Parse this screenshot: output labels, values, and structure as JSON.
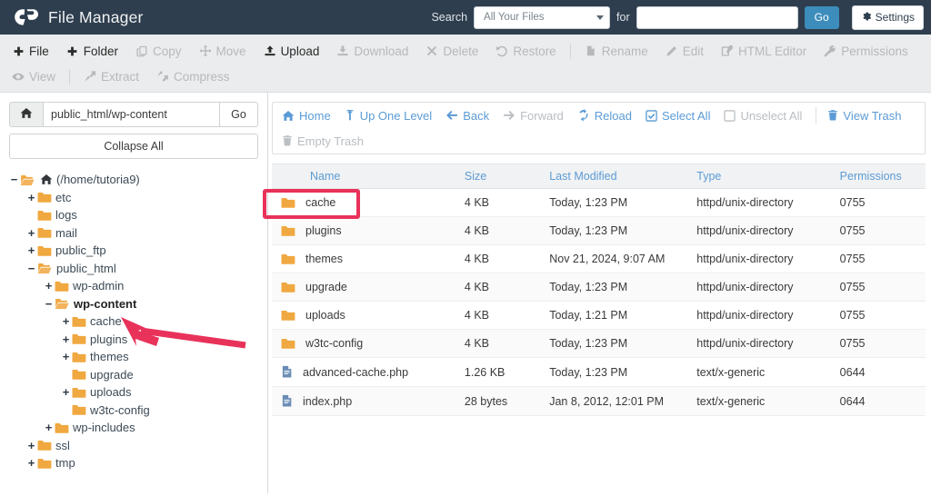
{
  "header": {
    "brand_title": "File Manager",
    "logo_icon": "cpanel-logo-icon",
    "search_label": "Search",
    "search_scope_value": "All Your Files",
    "for_label": "for",
    "search_value": "",
    "search_placeholder": "",
    "go_label": "Go",
    "settings_label": "Settings",
    "settings_icon": "gear-icon",
    "bg_color": "#2e3e4e",
    "accent_color": "#3c8dbc"
  },
  "toolbar": {
    "row1": [
      {
        "label": "File",
        "icon": "plus-icon",
        "enabled": true,
        "sep_after": false
      },
      {
        "label": "Folder",
        "icon": "plus-icon",
        "enabled": true,
        "sep_after": false
      },
      {
        "label": "Copy",
        "icon": "copy-icon",
        "enabled": false,
        "sep_after": false
      },
      {
        "label": "Move",
        "icon": "move-icon",
        "enabled": false,
        "sep_after": false
      },
      {
        "label": "Upload",
        "icon": "upload-icon",
        "enabled": true,
        "sep_after": false
      },
      {
        "label": "Download",
        "icon": "download-icon",
        "enabled": false,
        "sep_after": false
      },
      {
        "label": "Delete",
        "icon": "x-icon",
        "enabled": false,
        "sep_after": false
      },
      {
        "label": "Restore",
        "icon": "restore-icon",
        "enabled": false,
        "sep_after": true
      },
      {
        "label": "Rename",
        "icon": "file-icon",
        "enabled": false,
        "sep_after": false
      },
      {
        "label": "Edit",
        "icon": "pencil-icon",
        "enabled": false,
        "sep_after": false
      },
      {
        "label": "HTML Editor",
        "icon": "html-editor-icon",
        "enabled": false,
        "sep_after": false
      },
      {
        "label": "Permissions",
        "icon": "key-icon",
        "enabled": false,
        "sep_after": false
      }
    ],
    "row2": [
      {
        "label": "View",
        "icon": "eye-icon",
        "enabled": false,
        "sep_after": true
      },
      {
        "label": "Extract",
        "icon": "extract-icon",
        "enabled": false,
        "sep_after": false
      },
      {
        "label": "Compress",
        "icon": "compress-icon",
        "enabled": false,
        "sep_after": false
      }
    ]
  },
  "sidebar": {
    "home_icon": "home-icon",
    "path_value": "public_html/wp-content",
    "path_go_label": "Go",
    "collapse_label": "Collapse All",
    "tree": [
      {
        "label": "(/home/tutoria9)",
        "depth": 0,
        "toggle": "−",
        "icon": "folder-open-icon",
        "home": true,
        "bold": false
      },
      {
        "label": "etc",
        "depth": 1,
        "toggle": "+",
        "icon": "folder-icon",
        "home": false,
        "bold": false
      },
      {
        "label": "logs",
        "depth": 1,
        "toggle": "",
        "icon": "folder-icon",
        "home": false,
        "bold": false
      },
      {
        "label": "mail",
        "depth": 1,
        "toggle": "+",
        "icon": "folder-icon",
        "home": false,
        "bold": false
      },
      {
        "label": "public_ftp",
        "depth": 1,
        "toggle": "+",
        "icon": "folder-icon",
        "home": false,
        "bold": false
      },
      {
        "label": "public_html",
        "depth": 1,
        "toggle": "−",
        "icon": "folder-open-icon",
        "home": false,
        "bold": false
      },
      {
        "label": "wp-admin",
        "depth": 2,
        "toggle": "+",
        "icon": "folder-icon",
        "home": false,
        "bold": false
      },
      {
        "label": "wp-content",
        "depth": 2,
        "toggle": "−",
        "icon": "folder-open-icon",
        "home": false,
        "bold": true
      },
      {
        "label": "cache",
        "depth": 3,
        "toggle": "+",
        "icon": "folder-icon",
        "home": false,
        "bold": false
      },
      {
        "label": "plugins",
        "depth": 3,
        "toggle": "+",
        "icon": "folder-icon",
        "home": false,
        "bold": false
      },
      {
        "label": "themes",
        "depth": 3,
        "toggle": "+",
        "icon": "folder-icon",
        "home": false,
        "bold": false
      },
      {
        "label": "upgrade",
        "depth": 3,
        "toggle": "",
        "icon": "folder-icon",
        "home": false,
        "bold": false
      },
      {
        "label": "uploads",
        "depth": 3,
        "toggle": "+",
        "icon": "folder-icon",
        "home": false,
        "bold": false
      },
      {
        "label": "w3tc-config",
        "depth": 3,
        "toggle": "",
        "icon": "folder-icon",
        "home": false,
        "bold": false
      },
      {
        "label": "wp-includes",
        "depth": 2,
        "toggle": "+",
        "icon": "folder-icon",
        "home": false,
        "bold": false
      },
      {
        "label": "ssl",
        "depth": 1,
        "toggle": "+",
        "icon": "folder-icon",
        "home": false,
        "bold": false
      },
      {
        "label": "tmp",
        "depth": 1,
        "toggle": "+",
        "icon": "folder-icon",
        "home": false,
        "bold": false
      }
    ]
  },
  "filenav": {
    "row1": [
      {
        "label": "Home",
        "icon": "home-icon",
        "enabled": true,
        "sep_after": false
      },
      {
        "label": "Up One Level",
        "icon": "up-arrow-icon",
        "enabled": true,
        "sep_after": false
      },
      {
        "label": "Back",
        "icon": "arrow-left-icon",
        "enabled": true,
        "sep_after": false
      },
      {
        "label": "Forward",
        "icon": "arrow-right-icon",
        "enabled": false,
        "sep_after": false
      },
      {
        "label": "Reload",
        "icon": "reload-icon",
        "enabled": true,
        "sep_after": false
      },
      {
        "label": "Select All",
        "icon": "checkbox-checked-icon",
        "enabled": true,
        "sep_after": false
      },
      {
        "label": "Unselect All",
        "icon": "checkbox-empty-icon",
        "enabled": false,
        "sep_after": true
      },
      {
        "label": "View Trash",
        "icon": "trash-icon",
        "enabled": true,
        "sep_after": false
      }
    ],
    "row2": [
      {
        "label": "Empty Trash",
        "icon": "trash-icon",
        "enabled": false,
        "sep_after": false
      }
    ]
  },
  "filetable": {
    "columns": [
      "Name",
      "Size",
      "Last Modified",
      "Type",
      "Permissions"
    ],
    "rows": [
      {
        "icon": "folder-icon",
        "name": "cache",
        "size": "4 KB",
        "modified": "Today, 1:23 PM",
        "type": "httpd/unix-directory",
        "perms": "0755"
      },
      {
        "icon": "folder-icon",
        "name": "plugins",
        "size": "4 KB",
        "modified": "Today, 1:23 PM",
        "type": "httpd/unix-directory",
        "perms": "0755"
      },
      {
        "icon": "folder-icon",
        "name": "themes",
        "size": "4 KB",
        "modified": "Nov 21, 2024, 9:07 AM",
        "type": "httpd/unix-directory",
        "perms": "0755"
      },
      {
        "icon": "folder-icon",
        "name": "upgrade",
        "size": "4 KB",
        "modified": "Today, 1:23 PM",
        "type": "httpd/unix-directory",
        "perms": "0755"
      },
      {
        "icon": "folder-icon",
        "name": "uploads",
        "size": "4 KB",
        "modified": "Today, 1:21 PM",
        "type": "httpd/unix-directory",
        "perms": "0755"
      },
      {
        "icon": "folder-icon",
        "name": "w3tc-config",
        "size": "4 KB",
        "modified": "Today, 1:23 PM",
        "type": "httpd/unix-directory",
        "perms": "0755"
      },
      {
        "icon": "file-icon",
        "name": "advanced-cache.php",
        "size": "1.26 KB",
        "modified": "Today, 1:23 PM",
        "type": "text/x-generic",
        "perms": "0644"
      },
      {
        "icon": "file-icon",
        "name": "index.php",
        "size": "28 bytes",
        "modified": "Jan 8, 2012, 12:01 PM",
        "type": "text/x-generic",
        "perms": "0644"
      }
    ]
  },
  "annotations": {
    "highlight_color": "#e8325a",
    "highlight_target": "cache-row-name-cell",
    "arrow_color": "#e8325a",
    "arrow_target": "sidebar-tree-item-cache"
  }
}
